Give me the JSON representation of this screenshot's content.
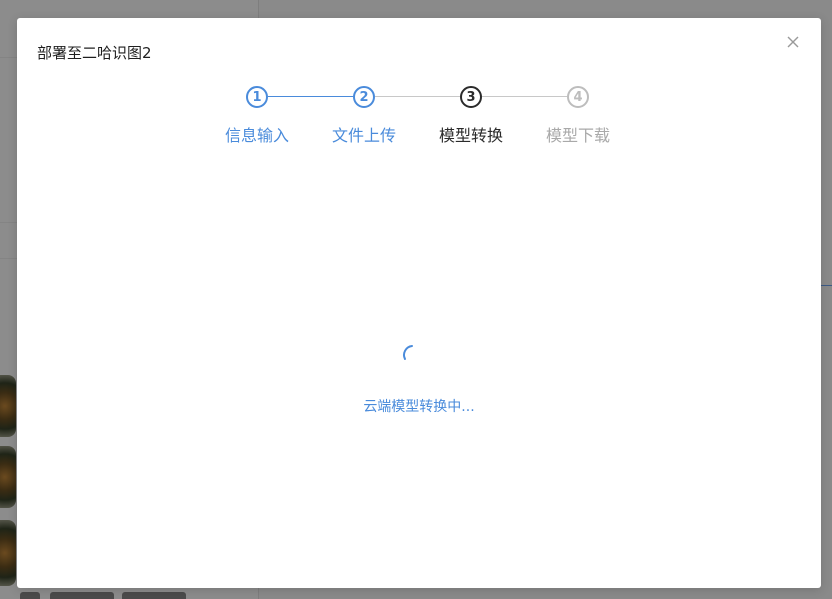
{
  "modal": {
    "title": "部署至二哈识图2",
    "close_icon": "close-icon"
  },
  "steps": [
    {
      "number": "1",
      "label": "信息输入",
      "state": "done"
    },
    {
      "number": "2",
      "label": "文件上传",
      "state": "done"
    },
    {
      "number": "3",
      "label": "模型转换",
      "state": "active"
    },
    {
      "number": "4",
      "label": "模型下载",
      "state": "pending"
    }
  ],
  "loading": {
    "text": "云端模型转换中...",
    "icon": "loading-spinner-icon"
  },
  "colors": {
    "accent": "#4a8bdb",
    "active": "#2b2b2b",
    "pending": "#bdbdbd",
    "overlay": "#8a8a8a"
  }
}
